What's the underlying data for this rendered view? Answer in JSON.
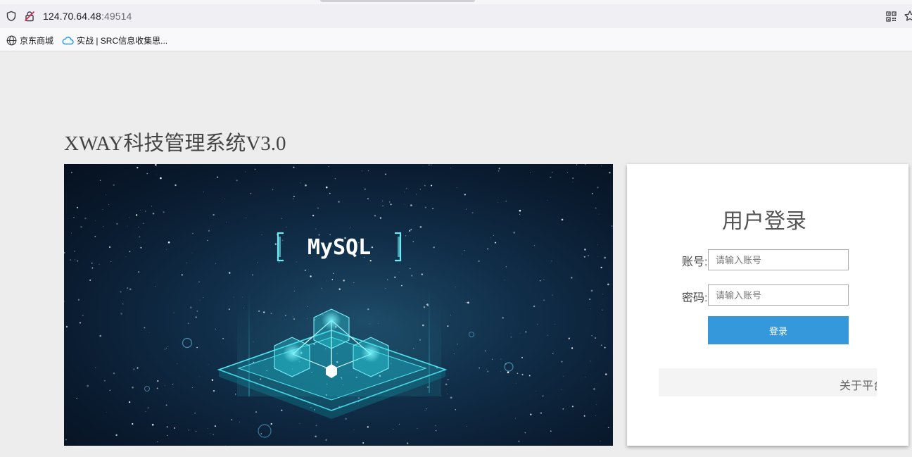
{
  "browser": {
    "url_host": "124.70.64.48",
    "url_port": ":49514",
    "bookmarks": [
      {
        "label": "京东商城",
        "icon": "globe-icon"
      },
      {
        "label": "实战 | SRC信息收集思...",
        "icon": "cloud-icon"
      }
    ]
  },
  "page": {
    "title": "XWAY科技管理系统V3.0",
    "banner": {
      "label": "MySQL"
    }
  },
  "login": {
    "title": "用户登录",
    "account_label": "账号:",
    "account_placeholder": "请输入账号",
    "password_label": "密码:",
    "password_placeholder": "请输入账号",
    "submit_label": "登录",
    "about_label": "关于平台"
  },
  "colors": {
    "accent": "#3498db",
    "page_bg": "#ededed",
    "banner_glow": "#3fe0e8"
  }
}
